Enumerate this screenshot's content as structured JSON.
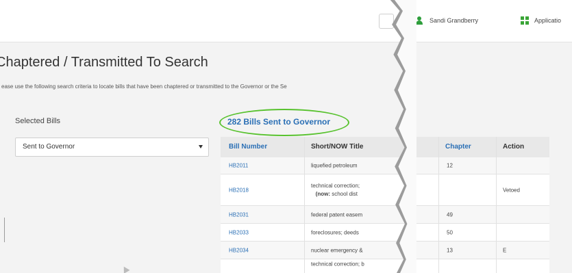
{
  "header": {
    "user_name": "Sandi Grandberry",
    "apps_label": "Applicatio"
  },
  "page": {
    "title": "Chaptered / Transmitted To Search",
    "description": "ease use the following search criteria to locate bills that have been chaptered or transmitted to the Governor or the Se"
  },
  "filter": {
    "label": "Selected Bills",
    "selected": "Sent to Governor"
  },
  "results": {
    "heading": "282 Bills Sent to Governor"
  },
  "table": {
    "columns": {
      "bill_number": "Bill Number",
      "short_title": "Short/NOW Title",
      "chapter": "Chapter",
      "action": "Action"
    },
    "rows": [
      {
        "bill": "HB2011",
        "title": "liquefied petroleum",
        "now": "",
        "now_text": "",
        "chapter": "12",
        "action": ""
      },
      {
        "bill": "HB2018",
        "title": "technical correction;",
        "now": "(now:",
        "now_text": "school dist",
        "chapter": "",
        "action": "Vetoed"
      },
      {
        "bill": "HB2031",
        "title": "federal patent easem",
        "now": "",
        "now_text": "",
        "chapter": "49",
        "action": ""
      },
      {
        "bill": "HB2033",
        "title": "foreclosures; deeds",
        "now": "",
        "now_text": "",
        "chapter": "50",
        "action": ""
      },
      {
        "bill": "HB2034",
        "title": "nuclear emergency &",
        "now": "",
        "now_text": "",
        "chapter": "13",
        "action": "E"
      },
      {
        "bill": "",
        "title": "technical correction; b",
        "now": "",
        "now_text": "",
        "chapter": "",
        "action": ""
      }
    ]
  },
  "colors": {
    "link": "#2a6fb5",
    "highlight_oval": "#58c22e",
    "icon_green": "#3aa537"
  },
  "icons": {
    "user": "user-icon",
    "apps": "apps-grid-icon",
    "dropdown": "chevron-down-icon"
  }
}
